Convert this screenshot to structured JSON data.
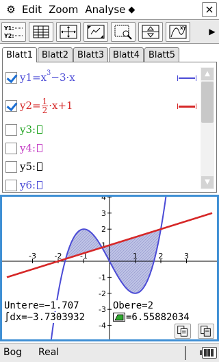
{
  "menubar": {
    "gear_icon": "gear-icon",
    "items": [
      "Edit",
      "Zoom",
      "Analyse"
    ],
    "more_icon": "diamond-menu-icon",
    "close_label": "×"
  },
  "toolbar": {
    "buttons": [
      {
        "name": "y-list-button",
        "label_top": "Y1:",
        "label_bottom": "Y2:"
      },
      {
        "name": "table-button",
        "icon": "table-icon"
      },
      {
        "name": "view-window-button",
        "icon": "view-window-icon"
      },
      {
        "name": "zoom-fit-button",
        "icon": "zoom-fit-icon"
      },
      {
        "name": "zoom-box-button",
        "icon": "zoom-box-icon"
      },
      {
        "name": "pan-button",
        "icon": "pan-icon"
      },
      {
        "name": "sketch-button",
        "icon": "sketch-xy-icon"
      }
    ],
    "more_label": "▶"
  },
  "tabs": [
    "Blatt1",
    "Blatt2",
    "Blatt3",
    "Blatt4",
    "Blatt5"
  ],
  "active_tab": 0,
  "equations": [
    {
      "id": "y1",
      "checked": true,
      "color": "#4b4bd6",
      "line_color": "#4b4bd6"
    },
    {
      "id": "y2",
      "checked": true,
      "color": "#d62828",
      "line_color": "#d62828"
    },
    {
      "id": "y3",
      "checked": false,
      "color": "#1fa31f",
      "label": "y3:"
    },
    {
      "id": "y4",
      "checked": false,
      "color": "#c43ec4",
      "label": "y4:"
    },
    {
      "id": "y5",
      "checked": false,
      "color": "#000000",
      "label": "y5:"
    },
    {
      "id": "y6",
      "checked": false,
      "color": "#4b4bd6",
      "label": "y6:"
    }
  ],
  "eq1": {
    "lhs": "y1=x",
    "exp": "3",
    "rest": "−3·x"
  },
  "eq2": {
    "lhs": "y2=",
    "num": "1",
    "den": "2",
    "rest": "·x+1"
  },
  "scroll": {
    "up": "▲",
    "down": "▼"
  },
  "graph": {
    "x_ticks": [
      "-3",
      "-2",
      "-1",
      "0",
      "1",
      "2",
      "3"
    ],
    "y_ticks": [
      "4",
      "3",
      "2",
      "1",
      "-1",
      "-2",
      "-3",
      "-4"
    ],
    "lower_label": "Untere=−1.707",
    "upper_label": "Obere=2",
    "integral_label": "∫dx=−3.7303932",
    "area_label": "=6.55882034",
    "area_icon": "area-icon"
  },
  "chart_data": {
    "type": "line",
    "title": "",
    "xlabel": "",
    "ylabel": "",
    "xlim": [
      -4,
      4
    ],
    "ylim": [
      -4,
      4
    ],
    "grid": false,
    "series": [
      {
        "name": "y1",
        "expression": "x^3-3x",
        "color": "#4b4bd6"
      },
      {
        "name": "y2",
        "expression": "1/2*x+1",
        "color": "#d62828"
      }
    ],
    "shaded_region": {
      "between": [
        "y1",
        "y2"
      ],
      "x_from": -1.707,
      "x_to": 2
    },
    "integral": -3.7303932,
    "area": 6.55882034
  },
  "statusbar": {
    "mode": "Bog",
    "number_format": "Real",
    "battery_icon": "battery-icon"
  }
}
